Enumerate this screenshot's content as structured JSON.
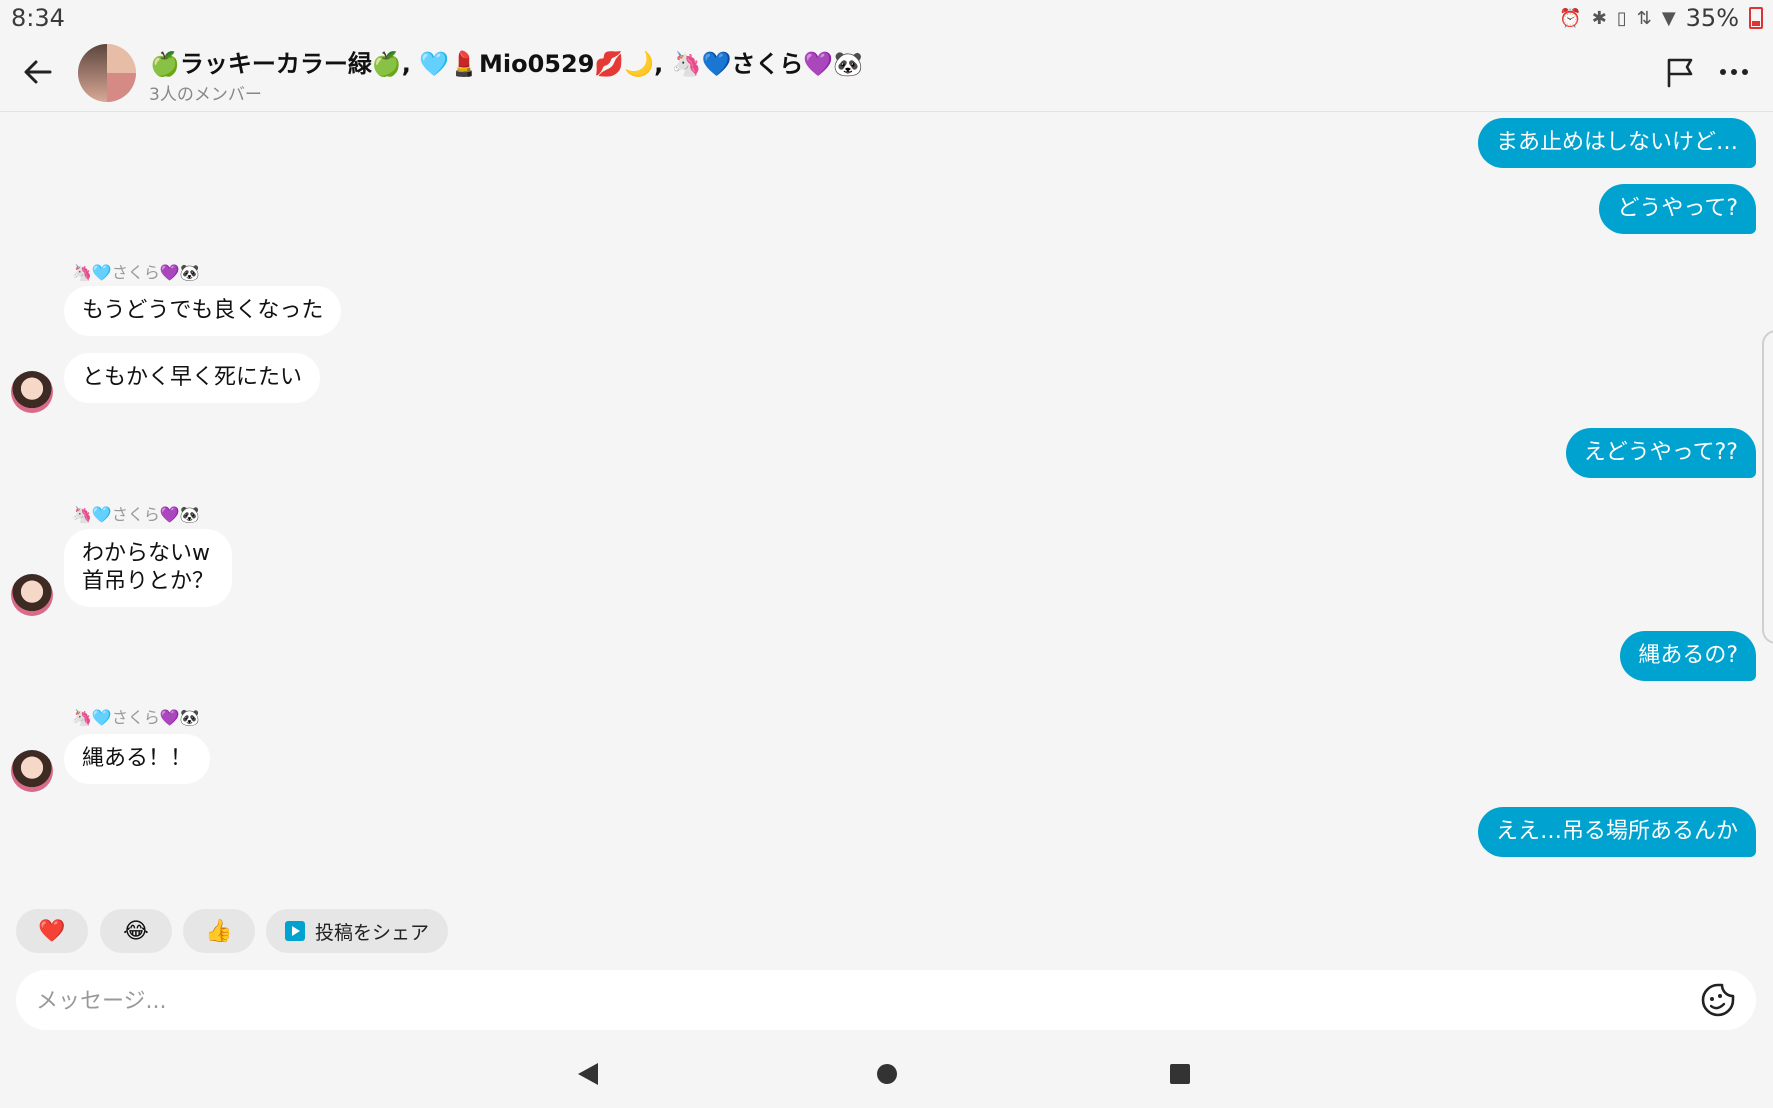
{
  "status_bar": {
    "time": "8:34",
    "battery": "35%",
    "icons": [
      "alarm-icon",
      "bluetooth-icon",
      "vibrate-icon",
      "data-arrows-icon",
      "wifi-icon",
      "battery-icon"
    ]
  },
  "header": {
    "title": "🍏ラッキーカラー緑🍏, 🩵💄Mio0529💋🌙, 🦄💙さくら💜🐼",
    "subtitle": "3人のメンバー"
  },
  "messages": [
    {
      "direction": "out",
      "text": "まあ止めはしないけど…"
    },
    {
      "direction": "out",
      "text": "どうやって?"
    },
    {
      "direction": "in",
      "sender": "🦄🩵さくら💜🐼",
      "text": "もうどうでも良くなった"
    },
    {
      "direction": "in",
      "text": "ともかく早く死にたい"
    },
    {
      "direction": "out",
      "text": "えどうやって??"
    },
    {
      "direction": "in",
      "sender": "🦄🩵さくら💜🐼",
      "text": "わからないw\n首吊りとか？"
    },
    {
      "direction": "out",
      "text": "縄あるの?"
    },
    {
      "direction": "in",
      "sender": "🦄🩵さくら💜🐼",
      "text": "縄ある！！"
    },
    {
      "direction": "out",
      "text": "ええ…吊る場所あるんか"
    }
  ],
  "quick_reactions": [
    {
      "emoji": "❤️"
    },
    {
      "emoji": "😂"
    },
    {
      "emoji": "👍"
    }
  ],
  "share_post": {
    "label": "投稿をシェア"
  },
  "composer": {
    "placeholder": "メッセージ..."
  },
  "colors": {
    "outgoing_bubble": "#00a3cf",
    "incoming_bubble": "#ffffff",
    "background": "#f5f5f5"
  }
}
